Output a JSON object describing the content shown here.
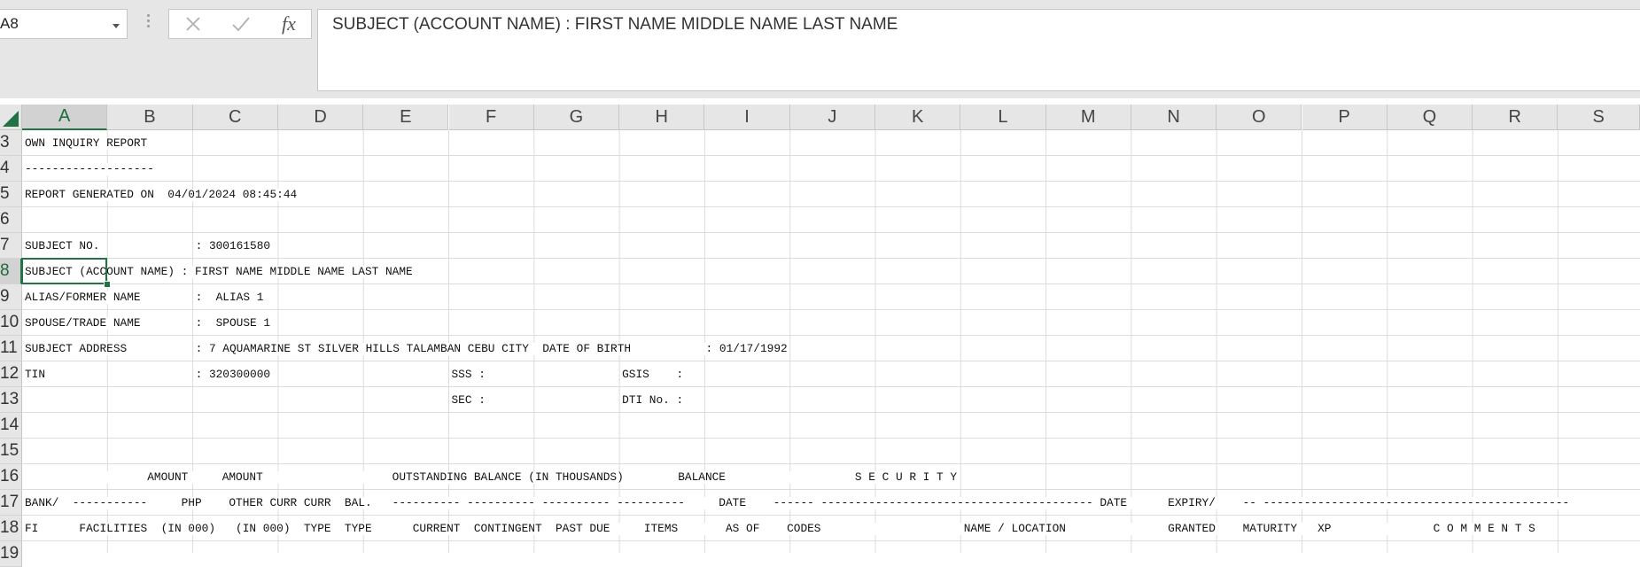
{
  "name_box": {
    "value": "A8"
  },
  "formula_bar": {
    "fx_label": "fx",
    "content": "SUBJECT (ACCOUNT NAME) : FIRST NAME MIDDLE NAME LAST NAME"
  },
  "columns": [
    "A",
    "B",
    "C",
    "D",
    "E",
    "F",
    "G",
    "H",
    "I",
    "J",
    "K",
    "L",
    "M",
    "N",
    "O",
    "P",
    "Q",
    "R",
    "S"
  ],
  "selected_column": "A",
  "rows": [
    {
      "num": "3",
      "texts": [
        {
          "col": 0,
          "text": "OWN INQUIRY REPORT"
        }
      ]
    },
    {
      "num": "4",
      "texts": [
        {
          "col": 0,
          "text": "-------------------"
        }
      ]
    },
    {
      "num": "5",
      "texts": [
        {
          "col": 0,
          "text": "REPORT GENERATED ON  04/01/2024 08:45:44"
        }
      ]
    },
    {
      "num": "6",
      "texts": []
    },
    {
      "num": "7",
      "texts": [
        {
          "col": 0,
          "text": "SUBJECT NO."
        },
        {
          "col": 2,
          "text": ": 300161580"
        }
      ]
    },
    {
      "num": "8",
      "texts": [
        {
          "col": 0,
          "text": "SUBJECT (ACCOUNT NAME) : FIRST NAME MIDDLE NAME LAST NAME"
        }
      ]
    },
    {
      "num": "9",
      "texts": [
        {
          "col": 0,
          "text": "ALIAS/FORMER NAME"
        },
        {
          "col": 2,
          "text": ":  ALIAS 1"
        }
      ]
    },
    {
      "num": "10",
      "texts": [
        {
          "col": 0,
          "text": "SPOUSE/TRADE NAME"
        },
        {
          "col": 2,
          "text": ":  SPOUSE 1"
        }
      ]
    },
    {
      "num": "11",
      "texts": [
        {
          "col": 0,
          "text": "SUBJECT ADDRESS"
        },
        {
          "col": 2,
          "text": ": 7 AQUAMARINE ST SILVER HILLS TALAMBAN CEBU CITY  DATE OF BIRTH           : 01/17/1992"
        }
      ]
    },
    {
      "num": "12",
      "texts": [
        {
          "col": 0,
          "text": "TIN"
        },
        {
          "col": 2,
          "text": ": 320300000"
        },
        {
          "col": 5,
          "text": "SSS :"
        },
        {
          "col": 7,
          "text": "GSIS    :"
        }
      ]
    },
    {
      "num": "13",
      "texts": [
        {
          "col": 5,
          "text": "SEC :"
        },
        {
          "col": 7,
          "text": "DTI No. :"
        }
      ]
    },
    {
      "num": "14",
      "texts": []
    },
    {
      "num": "15",
      "texts": []
    },
    {
      "num": "16",
      "texts": [
        {
          "col": 0,
          "text": "                  AMOUNT     AMOUNT                   OUTSTANDING BALANCE (IN THOUSANDS)        BALANCE                   S E C U R I T Y"
        }
      ]
    },
    {
      "num": "17",
      "texts": [
        {
          "col": 0,
          "text": "BANK/  -----------     PHP    OTHER CURR CURR  BAL.   ---------- ---------- ---------- ----------     DATE    ------ ---------------------------------------- DATE      EXPIRY/    -- ---------------------------------------------"
        }
      ]
    },
    {
      "num": "18",
      "texts": [
        {
          "col": 0,
          "text": "FI      FACILITIES  (IN 000)   (IN 000)  TYPE  TYPE      CURRENT  CONTINGENT  PAST DUE     ITEMS       AS OF    CODES                     NAME / LOCATION               GRANTED    MATURITY   XP               C O M M E N T S"
        }
      ]
    },
    {
      "num": "19",
      "texts": []
    }
  ],
  "selected_row": "8"
}
